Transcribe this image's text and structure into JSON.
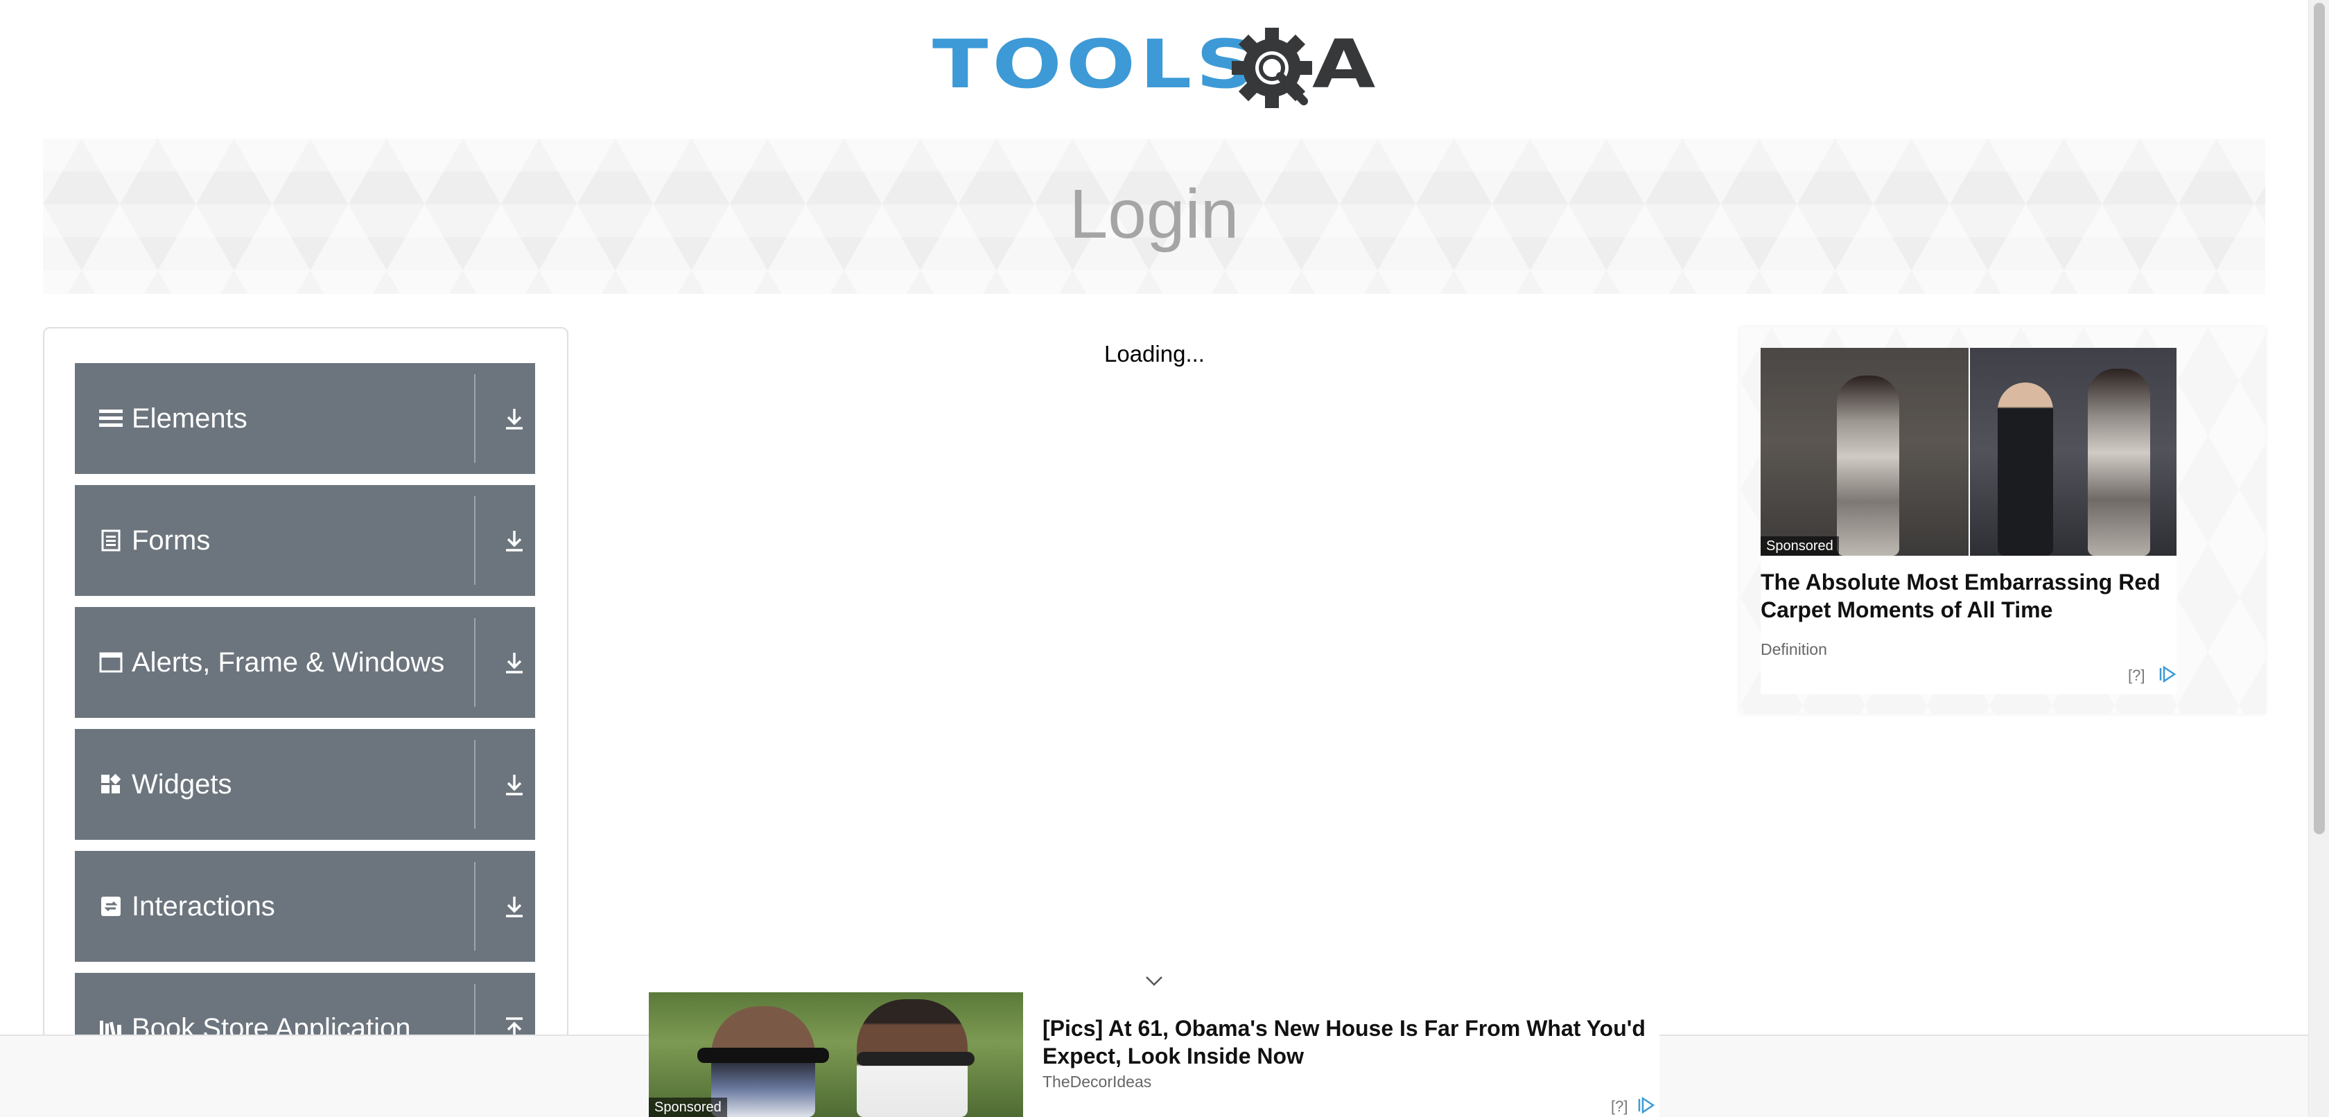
{
  "header": {
    "logo_text_blue": "TOOLS",
    "logo_text_dark": "A",
    "logo_gear_icon": "gear-magnifier-icon"
  },
  "banner": {
    "title": "Login"
  },
  "sidebar": {
    "groups": [
      {
        "label": "Elements",
        "icon": "hamburger-icon"
      },
      {
        "label": "Forms",
        "icon": "document-icon"
      },
      {
        "label": "Alerts, Frame & Windows",
        "icon": "window-icon"
      },
      {
        "label": "Widgets",
        "icon": "widgets-icon"
      },
      {
        "label": "Interactions",
        "icon": "interactions-icon"
      },
      {
        "label": "Book Store Application",
        "icon": "bookshelf-icon"
      }
    ]
  },
  "main": {
    "loading_text": "Loading..."
  },
  "ad_right": {
    "sponsored": "Sponsored",
    "headline": "The Absolute Most Embarrassing Red Carpet Moments of All Time",
    "source": "Definition",
    "help": "[?]"
  },
  "ad_bottom": {
    "sponsored": "Sponsored",
    "headline": "[Pics] At 61, Obama's New House Is Far From What You'd Expect, Look Inside Now",
    "source": "TheDecorIdeas",
    "help": "[?]"
  },
  "colors": {
    "accent_blue": "#3d9ad6",
    "sidebar_group_bg": "#6c757d",
    "banner_title": "#a5a5a5"
  }
}
